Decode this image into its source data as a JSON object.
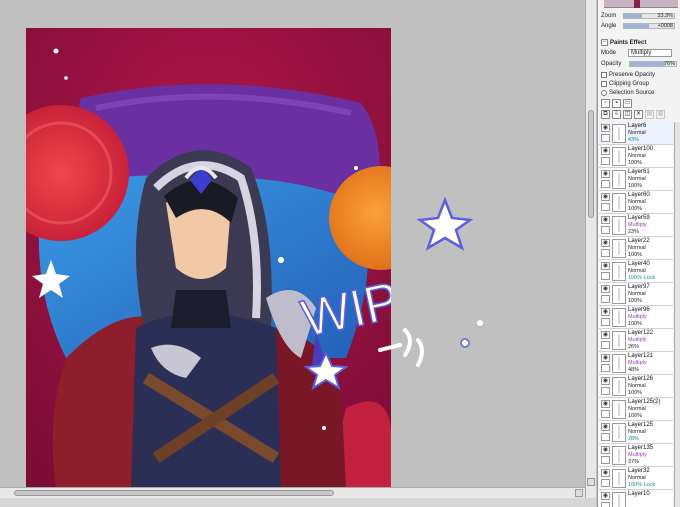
{
  "panel": {
    "zoom_label": "Zoom",
    "zoom_value": "33.3%",
    "angle_label": "Angle",
    "angle_value": "+0008",
    "paints_effect_label": "Paints Effect",
    "mode_label": "Mode",
    "mode_value": "Multiply",
    "opacity_label": "Opacity",
    "opacity_value": "76%",
    "opacity_fraction": 0.76,
    "preserve_opacity_label": "Preserve Opacity",
    "clipping_group_label": "Clipping Group",
    "selection_source_label": "Selection Source"
  },
  "layers": [
    {
      "name": "Layer6",
      "mode": "Normal",
      "opacity": "43%"
    },
    {
      "name": "Layer100",
      "mode": "Normal",
      "opacity": "100%"
    },
    {
      "name": "Layer61",
      "mode": "Normal",
      "opacity": "100%"
    },
    {
      "name": "Layer60",
      "mode": "Normal",
      "opacity": "100%"
    },
    {
      "name": "Layer59",
      "mode": "Multiply",
      "opacity": "23%"
    },
    {
      "name": "Layer22",
      "mode": "Normal",
      "opacity": "100%"
    },
    {
      "name": "Layer40",
      "mode": "Normal",
      "opacity": "100% Lock"
    },
    {
      "name": "Layer97",
      "mode": "Normal",
      "opacity": "100%"
    },
    {
      "name": "Layer96",
      "mode": "Multiply",
      "opacity": "100%"
    },
    {
      "name": "Layer122",
      "mode": "Multiply",
      "opacity": "26%"
    },
    {
      "name": "Layer121",
      "mode": "Multiply",
      "opacity": "48%"
    },
    {
      "name": "Layer126",
      "mode": "Normal",
      "opacity": "100%"
    },
    {
      "name": "Layer125(2)",
      "mode": "Normal",
      "opacity": "100%"
    },
    {
      "name": "Layer125",
      "mode": "Normal",
      "opacity": "28%"
    },
    {
      "name": "Layer135",
      "mode": "Multiply",
      "opacity": "37%"
    },
    {
      "name": "Layer32",
      "mode": "Normal",
      "opacity": "100% Lock"
    },
    {
      "name": "Layer10",
      "mode": "",
      "opacity": ""
    }
  ],
  "artwork": {
    "watermark_text": "WIP",
    "palette": {
      "background": "#8e0f3d",
      "cushion_purple": "#6a2fa0",
      "cushion_blue": "#2f7fd1",
      "orb_red": "#e8343f",
      "orb_orange": "#f38a1f",
      "hood": "#3b3a52",
      "cape": "#8e1e2c",
      "armor": "#2c2f55"
    }
  }
}
